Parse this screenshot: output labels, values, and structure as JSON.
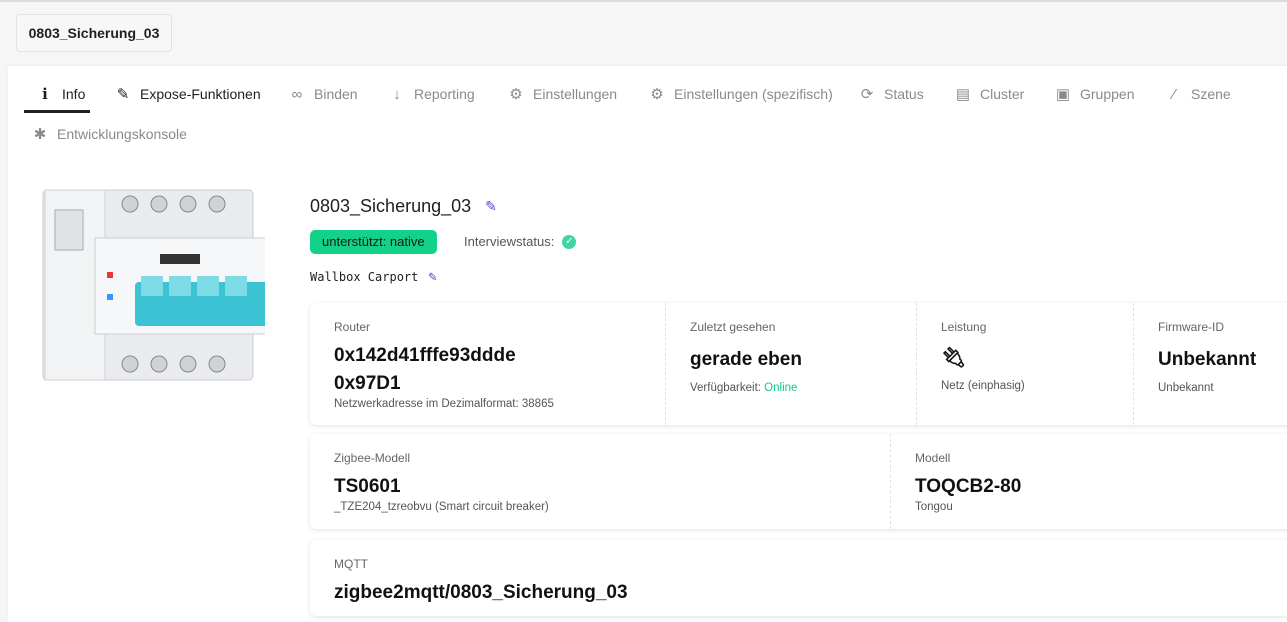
{
  "device_tab": "0803_Sicherung_03",
  "tabs": [
    {
      "label": "Info",
      "icon": "info-icon"
    },
    {
      "label": "Expose-Funktionen",
      "icon": "pencil-icon"
    },
    {
      "label": "Binden",
      "icon": "link-icon"
    },
    {
      "label": "Reporting",
      "icon": "arrow-down-icon"
    },
    {
      "label": "Einstellungen",
      "icon": "cogs-icon"
    },
    {
      "label": "Einstellungen (spezifisch)",
      "icon": "gear-icon"
    },
    {
      "label": "Status",
      "icon": "sync-icon"
    },
    {
      "label": "Cluster",
      "icon": "file-icon"
    },
    {
      "label": "Gruppen",
      "icon": "object-group-icon"
    },
    {
      "label": "Szene",
      "icon": "magic-wand-icon"
    },
    {
      "label": "Entwicklungskonsole",
      "icon": "bug-icon"
    }
  ],
  "device": {
    "name": "0803_Sicherung_03",
    "support_badge": "unterstützt: native",
    "interview_label": "Interviewstatus:",
    "description": "Wallbox Carport",
    "image_text": {
      "brand": "tongou",
      "model": "TOQCB2-80"
    }
  },
  "card1": {
    "router": {
      "label": "Router",
      "ieee": "0x142d41fffe93ddde",
      "nwk": "0x97D1",
      "sub": "Netzwerkadresse im Dezimalformat: 38865"
    },
    "last_seen": {
      "label": "Zuletzt gesehen",
      "value": "gerade eben",
      "avail_label": "Verfügbarkeit:",
      "avail_value": "Online"
    },
    "power": {
      "label": "Leistung",
      "sub": "Netz (einphasig)"
    },
    "firmware": {
      "label": "Firmware-ID",
      "value": "Unbekannt",
      "sub": "Unbekannt"
    }
  },
  "card2": {
    "zigbee": {
      "label": "Zigbee-Modell",
      "value": "TS0601",
      "sub": "_TZE204_tzreobvu (Smart circuit breaker)"
    },
    "model": {
      "label": "Modell",
      "value": "TOQCB2-80",
      "sub": "Tongou"
    }
  },
  "card3": {
    "label": "MQTT",
    "value": "zigbee2mqtt/0803_Sicherung_03"
  }
}
